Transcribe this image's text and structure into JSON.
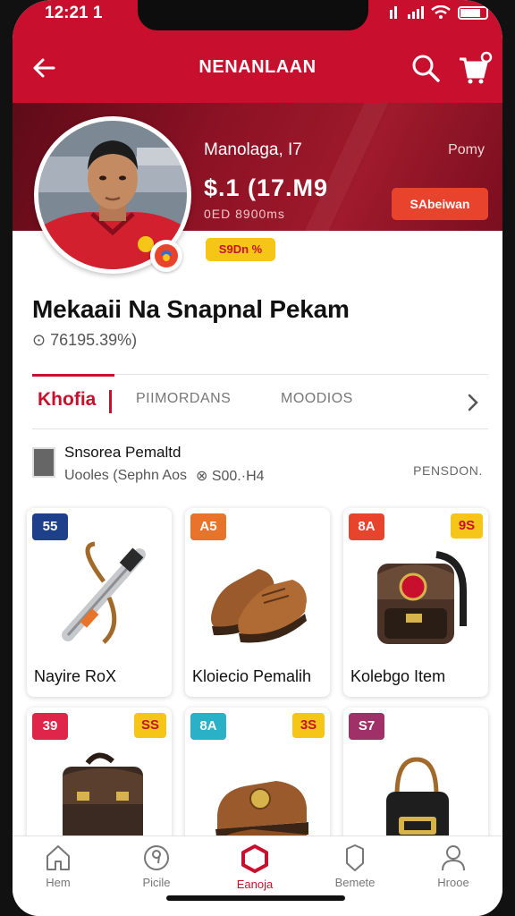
{
  "status_bar": {
    "time": "12:21 1"
  },
  "header": {
    "title": "NENANLAAN"
  },
  "banner": {
    "name": "Manolaga, I7",
    "pony": "Pomy",
    "amount": "$.1 (17.M9",
    "sub": "0ED 8900ms",
    "subscribe_label": "SAbeiwan",
    "tag": "S9Dn %"
  },
  "profile": {
    "name": "Mekaaii Na Snapnal Pekam",
    "stat": "⊙ 76195.39%)"
  },
  "tabs": {
    "active": "Khofia",
    "items": [
      "PIIMORDANS",
      "MOODIOS"
    ]
  },
  "seller": {
    "title": "Snsorea Pemaltd",
    "sub": "Uooles (Sephn Aos",
    "price": "⊗ S00.·H4",
    "right": "PENSDON."
  },
  "products": [
    {
      "badge": "55",
      "badge_color": "#1e3f8a",
      "badge2": "",
      "badge2_color": "",
      "label": "Nayire RoX",
      "icon": "instrument-icon"
    },
    {
      "badge": "A5",
      "badge_color": "#e8742c",
      "badge2": "",
      "badge2_color": "",
      "label": "Kloiecio Pemalih",
      "icon": "shoes-icon"
    },
    {
      "badge": "8A",
      "badge_color": "#e8432c",
      "badge2": "9S",
      "badge2_color": "#f5c518",
      "label": "Kolebgo Item",
      "icon": "bag-icon"
    },
    {
      "badge": "39",
      "badge_color": "#e0254a",
      "badge2": "SS",
      "badge2_color": "#f5c518",
      "label": "",
      "icon": "backpack-icon"
    },
    {
      "badge": "8A",
      "badge_color": "#2ab1c8",
      "badge2": "3S",
      "badge2_color": "#f5c518",
      "label": "",
      "icon": "loafer-icon"
    },
    {
      "badge": "S7",
      "badge_color": "#a03068",
      "badge2": "",
      "badge2_color": "",
      "label": "",
      "icon": "handbag-icon"
    }
  ],
  "nav": {
    "items": [
      {
        "label": "Hem",
        "icon": "home-icon"
      },
      {
        "label": "Picile",
        "icon": "profile-icon"
      },
      {
        "label": "Eanoja",
        "icon": "hexagon-icon"
      },
      {
        "label": "Bemete",
        "icon": "shield-icon"
      },
      {
        "label": "Hrooe",
        "icon": "user-icon"
      }
    ]
  },
  "colors": {
    "brand_red": "#c8102e",
    "banner_dark": "#6e0c1c",
    "accent_orange": "#e8432c",
    "accent_yellow": "#f5c518"
  }
}
